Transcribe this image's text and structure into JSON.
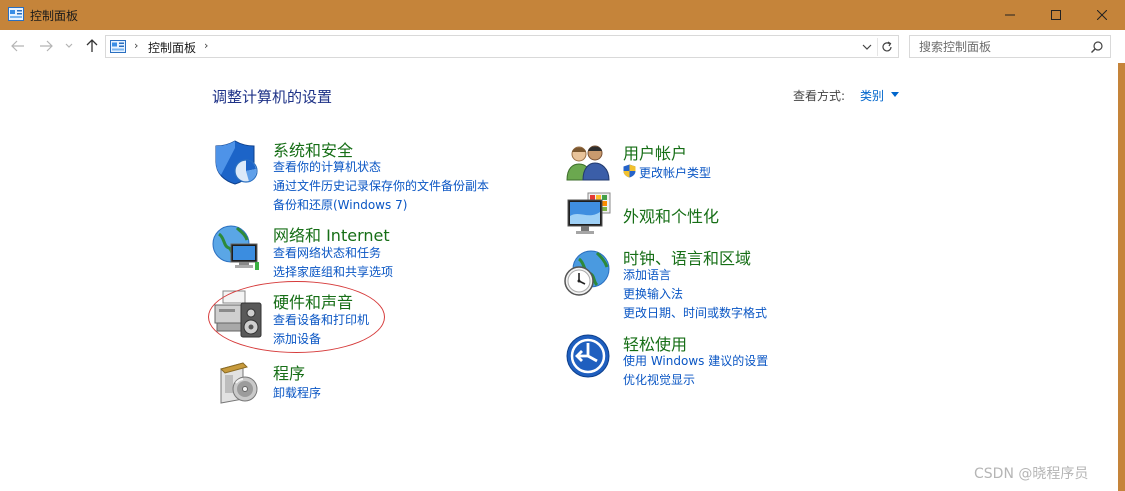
{
  "window": {
    "title": "控制面板"
  },
  "address": {
    "crumb": "控制面板",
    "sep": "›"
  },
  "search": {
    "placeholder": "搜索控制面板"
  },
  "main": {
    "heading": "调整计算机的设置",
    "view_by_label": "查看方式:",
    "view_by_value": "类别"
  },
  "categories_left": [
    {
      "title": "系统和安全",
      "links": [
        "查看你的计算机状态",
        "通过文件历史记录保存你的文件备份副本",
        "备份和还原(Windows 7)"
      ]
    },
    {
      "title": "网络和 Internet",
      "links": [
        "查看网络状态和任务",
        "选择家庭组和共享选项"
      ]
    },
    {
      "title": "硬件和声音",
      "links": [
        "查看设备和打印机",
        "添加设备"
      ]
    },
    {
      "title": "程序",
      "links": [
        "卸载程序"
      ]
    }
  ],
  "categories_right": [
    {
      "title": "用户帐户",
      "links": [
        "更改帐户类型"
      ]
    },
    {
      "title": "外观和个性化",
      "links": []
    },
    {
      "title": "时钟、语言和区域",
      "links": [
        "添加语言",
        "更换输入法",
        "更改日期、时间或数字格式"
      ]
    },
    {
      "title": "轻松使用",
      "links": [
        "使用 Windows 建议的设置",
        "优化视觉显示"
      ]
    }
  ],
  "watermark": "CSDN @晓程序员",
  "colors": {
    "titlebar": "#c5843a",
    "link": "#0a56c4",
    "category": "#166e16",
    "heading": "#1e3287",
    "annotation": "#d63b3b"
  }
}
